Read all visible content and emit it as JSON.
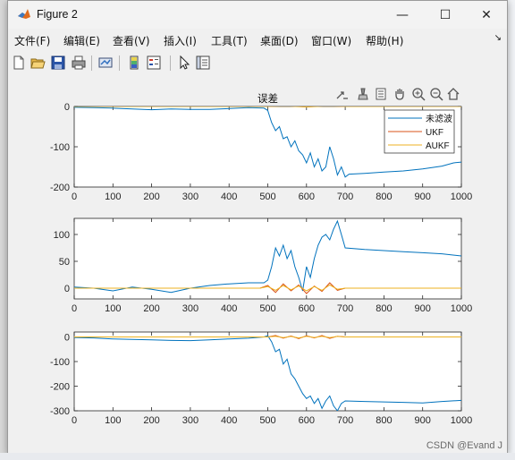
{
  "window": {
    "title": "Figure 2"
  },
  "window_controls": {
    "minimize": "—",
    "maximize": "☐",
    "close": "✕"
  },
  "menu": {
    "items": [
      "文件(F)",
      "编辑(E)",
      "查看(V)",
      "插入(I)",
      "工具(T)",
      "桌面(D)",
      "窗口(W)",
      "帮助(H)"
    ],
    "overflow": "↘"
  },
  "watermark": "CSDN @Evand J",
  "colors": {
    "series1": "#0072bd",
    "series2": "#d95319",
    "series3": "#edb120"
  },
  "chart_data": [
    {
      "type": "line",
      "title": "误差",
      "xlim": [
        0,
        1000
      ],
      "ylim": [
        -200,
        0
      ],
      "xticks": [
        0,
        100,
        200,
        300,
        400,
        500,
        600,
        700,
        800,
        900,
        1000
      ],
      "yticks": [
        0,
        -100,
        -200
      ],
      "legend": {
        "placement": "top-right",
        "entries": [
          "未滤波",
          "UKF",
          "AUKF"
        ]
      },
      "series": [
        {
          "name": "未滤波",
          "color": "#0072bd",
          "x": [
            0,
            50,
            100,
            150,
            200,
            250,
            300,
            350,
            400,
            450,
            490,
            500,
            510,
            520,
            530,
            540,
            550,
            560,
            570,
            580,
            590,
            600,
            610,
            620,
            630,
            640,
            650,
            660,
            670,
            680,
            690,
            700,
            710,
            750,
            800,
            850,
            900,
            950,
            980,
            1000
          ],
          "y": [
            -2,
            -3,
            -4,
            -6,
            -8,
            -6,
            -7,
            -7,
            -5,
            -3,
            -4,
            -10,
            -40,
            -60,
            -50,
            -80,
            -75,
            -100,
            -85,
            -110,
            -120,
            -140,
            -115,
            -150,
            -130,
            -160,
            -150,
            -100,
            -130,
            -170,
            -150,
            -175,
            -168,
            -166,
            -163,
            -160,
            -155,
            -148,
            -140,
            -138
          ]
        },
        {
          "name": "UKF",
          "color": "#d95319",
          "x": [
            0,
            100,
            200,
            300,
            400,
            500,
            550,
            600,
            650,
            700,
            800,
            900,
            1000
          ],
          "y": [
            0,
            0,
            0,
            0,
            0,
            0,
            2,
            -1,
            2,
            0,
            0,
            0,
            0
          ]
        },
        {
          "name": "AUKF",
          "color": "#edb120",
          "x": [
            0,
            100,
            200,
            300,
            400,
            500,
            550,
            600,
            650,
            700,
            800,
            900,
            1000
          ],
          "y": [
            0,
            0,
            0,
            0,
            0,
            0,
            1,
            -1,
            1,
            0,
            0,
            0,
            0
          ]
        }
      ]
    },
    {
      "type": "line",
      "title": "",
      "xlim": [
        0,
        1000
      ],
      "ylim": [
        -20,
        130
      ],
      "xticks": [
        0,
        100,
        200,
        300,
        400,
        500,
        600,
        700,
        800,
        900,
        1000
      ],
      "yticks": [
        100,
        50,
        0
      ],
      "series": [
        {
          "name": "未滤波",
          "color": "#0072bd",
          "x": [
            0,
            50,
            100,
            150,
            200,
            250,
            300,
            350,
            400,
            450,
            490,
            500,
            510,
            520,
            530,
            540,
            550,
            560,
            570,
            580,
            590,
            600,
            610,
            620,
            630,
            640,
            650,
            660,
            670,
            680,
            690,
            700,
            750,
            800,
            850,
            900,
            950,
            1000
          ],
          "y": [
            2,
            0,
            -5,
            2,
            -2,
            -8,
            0,
            5,
            8,
            10,
            10,
            15,
            40,
            75,
            60,
            80,
            55,
            70,
            40,
            20,
            -5,
            40,
            20,
            55,
            80,
            95,
            100,
            90,
            110,
            125,
            100,
            75,
            72,
            70,
            68,
            66,
            64,
            60
          ]
        },
        {
          "name": "UKF",
          "color": "#d95319",
          "x": [
            0,
            100,
            200,
            300,
            400,
            480,
            500,
            520,
            540,
            560,
            580,
            600,
            620,
            640,
            660,
            680,
            700,
            800,
            900,
            1000
          ],
          "y": [
            0,
            0,
            0,
            0,
            0,
            0,
            5,
            -8,
            8,
            -5,
            6,
            -10,
            4,
            -6,
            10,
            -4,
            0,
            0,
            0,
            0
          ]
        },
        {
          "name": "AUKF",
          "color": "#edb120",
          "x": [
            0,
            100,
            200,
            300,
            400,
            480,
            500,
            520,
            540,
            560,
            580,
            600,
            620,
            640,
            660,
            680,
            700,
            800,
            900,
            1000
          ],
          "y": [
            0,
            0,
            0,
            0,
            0,
            0,
            3,
            -4,
            5,
            -3,
            4,
            -5,
            3,
            -4,
            6,
            -2,
            0,
            0,
            0,
            0
          ]
        }
      ]
    },
    {
      "type": "line",
      "title": "",
      "xlim": [
        0,
        1000
      ],
      "ylim": [
        -300,
        20
      ],
      "xticks": [
        0,
        100,
        200,
        300,
        400,
        500,
        600,
        700,
        800,
        900,
        1000
      ],
      "yticks": [
        0,
        -100,
        -200,
        -300
      ],
      "series": [
        {
          "name": "未滤波",
          "color": "#0072bd",
          "x": [
            0,
            50,
            100,
            150,
            200,
            250,
            300,
            350,
            400,
            450,
            490,
            500,
            510,
            520,
            530,
            540,
            550,
            560,
            570,
            580,
            590,
            600,
            610,
            620,
            630,
            640,
            650,
            660,
            670,
            680,
            690,
            700,
            750,
            800,
            850,
            900,
            950,
            1000
          ],
          "y": [
            -2,
            -4,
            -8,
            -10,
            -12,
            -14,
            -15,
            -12,
            -8,
            -5,
            0,
            5,
            -20,
            -60,
            -50,
            -110,
            -90,
            -150,
            -170,
            -200,
            -230,
            -250,
            -240,
            -270,
            -250,
            -290,
            -260,
            -240,
            -280,
            -300,
            -270,
            -260,
            -262,
            -264,
            -266,
            -268,
            -262,
            -258
          ]
        },
        {
          "name": "UKF",
          "color": "#d95319",
          "x": [
            0,
            100,
            200,
            300,
            400,
            500,
            520,
            540,
            560,
            580,
            600,
            620,
            640,
            660,
            680,
            700,
            800,
            900,
            1000
          ],
          "y": [
            0,
            0,
            0,
            0,
            0,
            0,
            6,
            -5,
            4,
            -7,
            5,
            -4,
            6,
            -6,
            3,
            0,
            0,
            0,
            0
          ]
        },
        {
          "name": "AUKF",
          "color": "#edb120",
          "x": [
            0,
            100,
            200,
            300,
            400,
            500,
            520,
            540,
            560,
            580,
            600,
            620,
            640,
            660,
            680,
            700,
            800,
            900,
            1000
          ],
          "y": [
            0,
            0,
            0,
            0,
            0,
            0,
            3,
            -3,
            2,
            -4,
            3,
            -2,
            3,
            -3,
            2,
            0,
            0,
            0,
            0
          ]
        }
      ]
    }
  ]
}
